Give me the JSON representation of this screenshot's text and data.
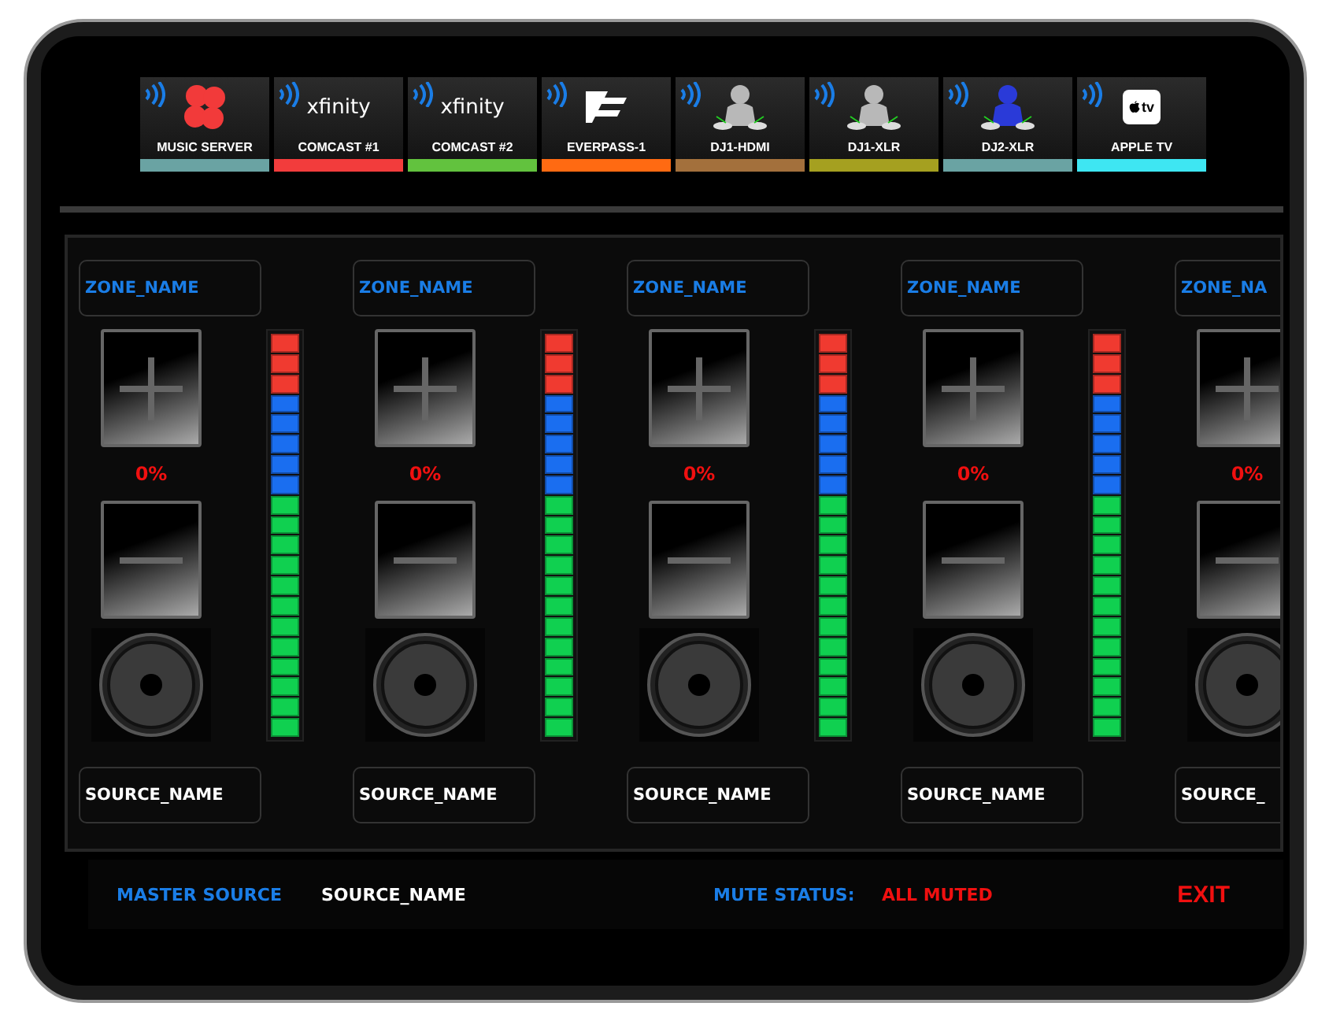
{
  "sources": [
    {
      "label": "MUSIC SERVER",
      "color": "#6aa3a3",
      "logo": {
        "kind": "flower"
      }
    },
    {
      "label": "COMCAST #1",
      "color": "#f23c3c",
      "logo": {
        "kind": "wordmark",
        "text": "xfinity"
      }
    },
    {
      "label": "COMCAST #2",
      "color": "#62c23e",
      "logo": {
        "kind": "wordmark",
        "text": "xfinity"
      }
    },
    {
      "label": "EVERPASS-1",
      "color": "#ff6a12",
      "logo": {
        "kind": "flag"
      }
    },
    {
      "label": "DJ1-HDMI",
      "color": "#a3703c",
      "logo": {
        "kind": "dj",
        "color": "#b8b8b8"
      }
    },
    {
      "label": "DJ1-XLR",
      "color": "#a5a020",
      "logo": {
        "kind": "dj",
        "color": "#b8b8b8"
      }
    },
    {
      "label": "DJ2-XLR",
      "color": "#6aa3a3",
      "logo": {
        "kind": "dj",
        "color": "#2a3ad8"
      }
    },
    {
      "label": "APPLE TV",
      "color": "#3ee6f2",
      "logo": {
        "kind": "appletv",
        "text": "tv"
      }
    }
  ],
  "zones": [
    {
      "name": "ZONE_NAME",
      "volume": "0%",
      "source": "SOURCE_NAME"
    },
    {
      "name": "ZONE_NAME",
      "volume": "0%",
      "source": "SOURCE_NAME"
    },
    {
      "name": "ZONE_NAME",
      "volume": "0%",
      "source": "SOURCE_NAME"
    },
    {
      "name": "ZONE_NAME",
      "volume": "0%",
      "source": "SOURCE_NAME"
    },
    {
      "name": "ZONE_NA",
      "volume": "0%",
      "source": "SOURCE_"
    }
  ],
  "status_bar": {
    "master_label": "MASTER SOURCE",
    "master_value": "SOURCE_NAME",
    "mute_label": "MUTE STATUS:",
    "mute_value": "ALL MUTED",
    "exit": "EXIT"
  }
}
